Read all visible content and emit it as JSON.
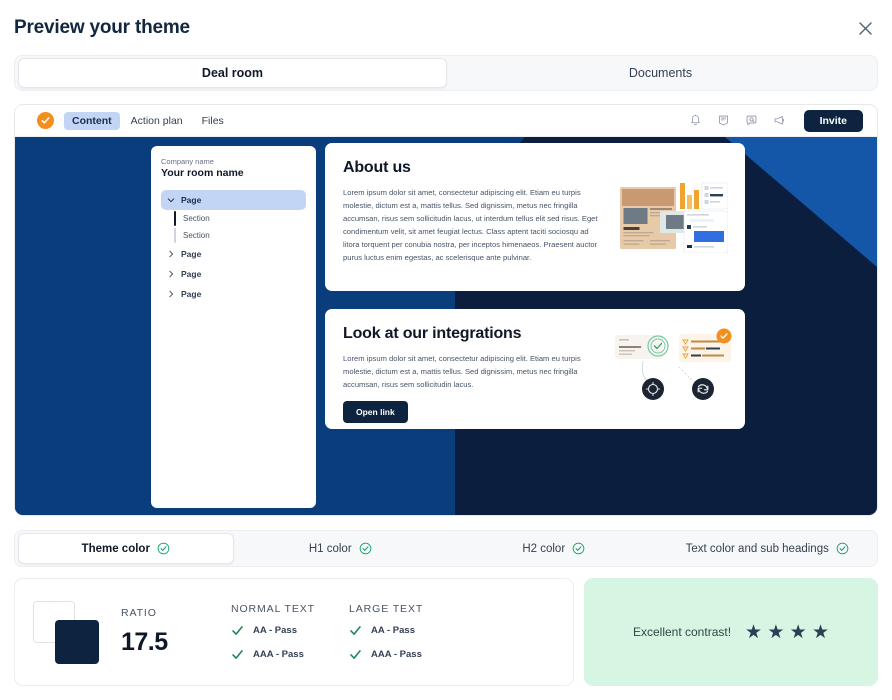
{
  "header": {
    "title": "Preview your theme",
    "close_icon": "close-icon"
  },
  "view_tabs": [
    {
      "label": "Deal room",
      "active": true
    },
    {
      "label": "Documents",
      "active": false
    }
  ],
  "preview": {
    "app_bar": {
      "logo_icon": "check-badge-logo-icon",
      "nav": [
        {
          "label": "Content",
          "active": true
        },
        {
          "label": "Action plan",
          "active": false
        },
        {
          "label": "Files",
          "active": false
        }
      ],
      "icons": [
        "bell-icon",
        "notes-icon",
        "search-chat-icon",
        "megaphone-icon"
      ],
      "invite_label": "Invite"
    },
    "sidebar": {
      "company_name": "Company name",
      "room_name": "Your room name",
      "tree": [
        {
          "label": "Page",
          "type": "page",
          "active": true,
          "expanded": true
        },
        {
          "label": "Section",
          "type": "section",
          "current": true
        },
        {
          "label": "Section",
          "type": "section",
          "current": false
        },
        {
          "label": "Page",
          "type": "page",
          "active": false,
          "expanded": false
        },
        {
          "label": "Page",
          "type": "page",
          "active": false,
          "expanded": false
        },
        {
          "label": "Page",
          "type": "page",
          "active": false,
          "expanded": false
        }
      ]
    },
    "cards": [
      {
        "title": "About us",
        "body": "Lorem ipsum dolor sit amet, consectetur adipiscing elit. Etiam eu turpis molestie, dictum est a, mattis tellus. Sed dignissim, metus nec fringilla accumsan, risus sem sollicitudin lacus, ut interdum tellus elit sed risus. Eget condimentum velit, sit amet feugiat lectus. Class aptent taciti sociosqu ad litora torquent per conubia nostra, per inceptos himenaeos. Praesent auctor purus luctus enim egestas, ac scelerisque ante pulvinar.",
        "illustration": "document-collage-illustration"
      },
      {
        "title": "Look at our integrations",
        "body": "Lorem ipsum dolor sit amet, consectetur adipiscing elit. Etiam eu turpis molestie, dictum est a, mattis tellus. Sed dignissim, metus nec fringilla accumsan, risus sem sollicitudin lacus.",
        "button_label": "Open link",
        "illustration": "integrations-illustration"
      }
    ],
    "theme_colors": {
      "background_dark": "#0b1e3d",
      "background_mid": "#0a3d7c",
      "background_accent": "#1456a8"
    }
  },
  "color_tabs": [
    {
      "label": "Theme color",
      "active": true,
      "status_icon": "check-circle-icon"
    },
    {
      "label": "H1 color",
      "active": false,
      "status_icon": "check-circle-icon"
    },
    {
      "label": "H2 color",
      "active": false,
      "status_icon": "check-circle-icon"
    },
    {
      "label": "Text color and sub headings",
      "active": false,
      "status_icon": "check-circle-icon"
    }
  ],
  "contrast_result": {
    "swatch_back_color": "#ffffff",
    "swatch_front_color": "#0d2340",
    "ratio_label": "RATIO",
    "ratio_value": "17.5",
    "normal_text": {
      "header": "NORMAL TEXT",
      "rows": [
        {
          "label": "AA - Pass",
          "icon": "check-icon"
        },
        {
          "label": "AAA - Pass",
          "icon": "check-icon"
        }
      ]
    },
    "large_text": {
      "header": "LARGE TEXT",
      "rows": [
        {
          "label": "AA - Pass",
          "icon": "check-icon"
        },
        {
          "label": "AAA - Pass",
          "icon": "check-icon"
        }
      ]
    },
    "verdict": "Excellent contrast!",
    "stars": "★ ★ ★ ★",
    "verdict_bg": "#d6f5e3"
  }
}
